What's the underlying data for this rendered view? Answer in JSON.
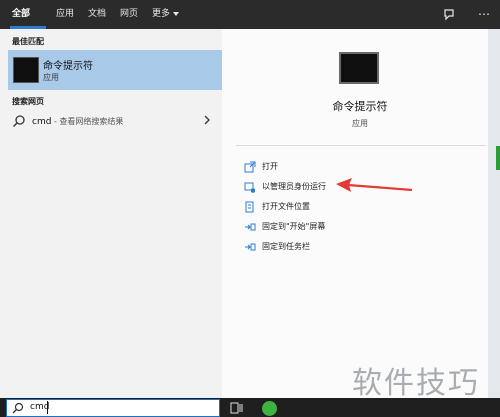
{
  "tabs": [
    {
      "label": "全部",
      "active": true
    },
    {
      "label": "应用",
      "active": false
    },
    {
      "label": "文档",
      "active": false
    },
    {
      "label": "网页",
      "active": false
    },
    {
      "label": "更多",
      "active": false
    }
  ],
  "left": {
    "best_match_title": "最佳匹配",
    "best_match": {
      "title": "命令提示符",
      "subtitle": "应用"
    },
    "web_title": "搜索网页",
    "web_item": {
      "query": "cmd",
      "suffix": " - 查看网络搜索结果"
    }
  },
  "right": {
    "app_title": "命令提示符",
    "app_type": "应用",
    "actions": [
      {
        "label": "打开",
        "icon": "open-icon"
      },
      {
        "label": "以管理员身份运行",
        "icon": "run-as-admin-icon"
      },
      {
        "label": "打开文件位置",
        "icon": "file-location-icon"
      },
      {
        "label": "固定到\"开始\"屏幕",
        "icon": "pin-start-icon"
      },
      {
        "label": "固定到任务栏",
        "icon": "pin-taskbar-icon"
      }
    ]
  },
  "search": {
    "value": "cmd"
  },
  "watermark": "软件技巧",
  "colors": {
    "accent": "#2f7bd0",
    "selected": "#a9c9e9",
    "arrow": "#e53935",
    "taskbar": "#1f1f1f"
  }
}
